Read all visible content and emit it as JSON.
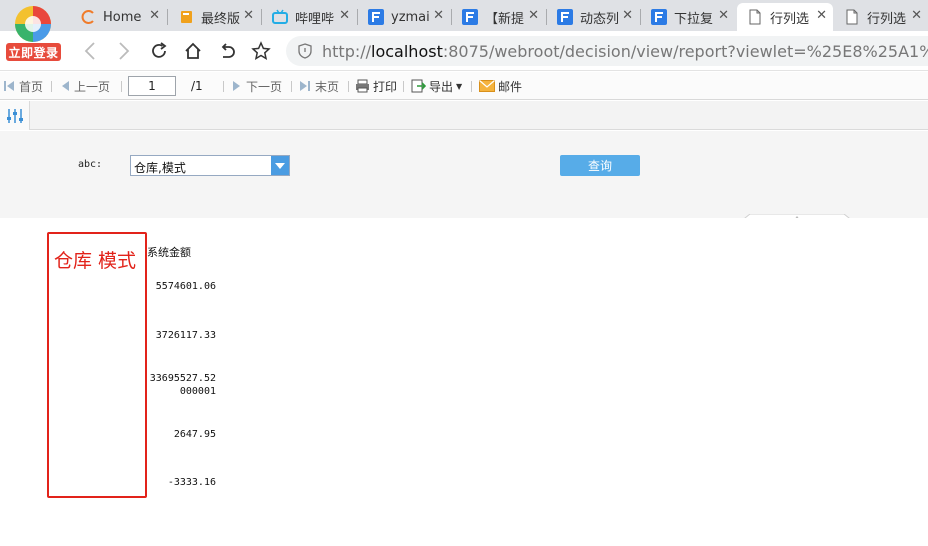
{
  "browser": {
    "login_button": "立即登录",
    "tabs": [
      {
        "label": "Home",
        "icon": "loading-circle-icon"
      },
      {
        "label": "最终版",
        "icon": "book-icon"
      },
      {
        "label": "哔哩哔",
        "icon": "bilibili-icon"
      },
      {
        "label": "yzmai",
        "icon": "fanruan-icon"
      },
      {
        "label": "【新提",
        "icon": "fanruan-icon"
      },
      {
        "label": "动态列",
        "icon": "fanruan-icon"
      },
      {
        "label": "下拉复",
        "icon": "fanruan-icon"
      },
      {
        "label": "行列选",
        "icon": "page-icon",
        "active": true
      },
      {
        "label": "行列选",
        "icon": "page-icon"
      }
    ],
    "url": {
      "scheme": "http://",
      "host": "localhost",
      "rest": ":8075/webroot/decision/view/report?viewlet=%25E8%25A1%258C%25E5%25"
    }
  },
  "toolbar": {
    "first": "首页",
    "prev": "上一页",
    "page_value": "1",
    "page_total": "/1",
    "next": "下一页",
    "last": "末页",
    "print": "打印",
    "export": "导出",
    "mail": "邮件"
  },
  "params": {
    "abc_label": "abc:",
    "combo_value": "仓库,模式",
    "query_button": "查询"
  },
  "report": {
    "category_header": "仓库 模式",
    "column_header": "系统金额",
    "values": [
      "5574601.06",
      "3726117.33",
      "33695527.52\n000001",
      "2647.95",
      "-3333.16"
    ]
  },
  "colors": {
    "accent": "#57ace8",
    "highlight": "#e2231a",
    "login": "#e74b3c"
  }
}
